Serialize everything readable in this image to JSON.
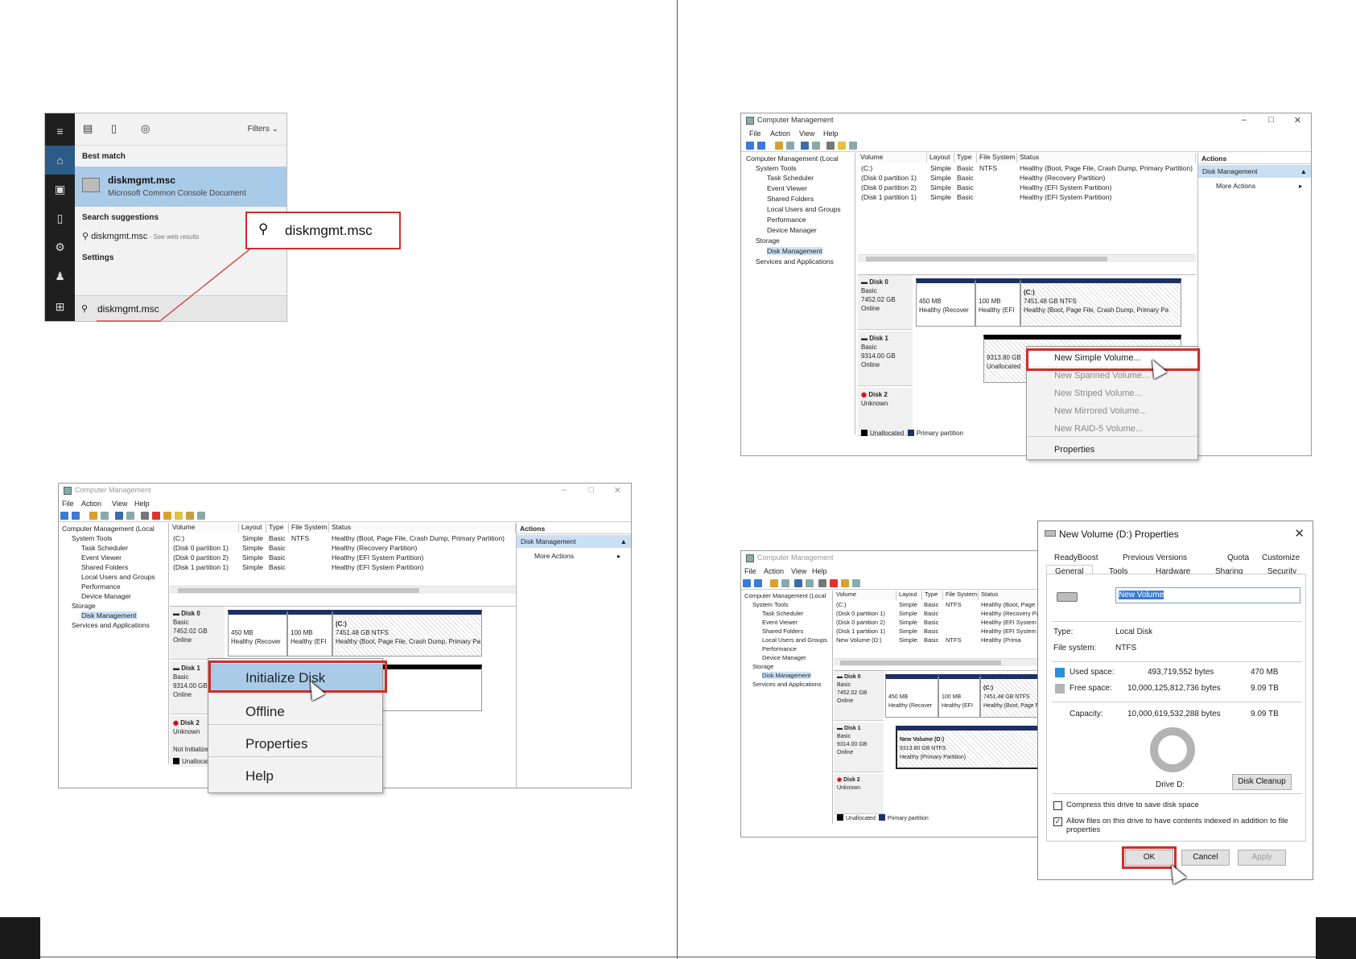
{
  "search": {
    "filters": "Filters",
    "best_match_heading": "Best match",
    "result_title": "diskmgmt.msc",
    "result_subtitle": "Microsoft Common Console Document",
    "suggestions_heading": "Search suggestions",
    "suggestion": "diskmgmt.msc",
    "suggestion_hint": " - See web results",
    "settings_heading": "Settings",
    "query": "diskmgmt.msc",
    "callout_query": "diskmgmt.msc"
  },
  "cm": {
    "title": "Computer Management",
    "menu": [
      "File",
      "Action",
      "View",
      "Help"
    ],
    "tree": {
      "root": "Computer Management (Local",
      "system_tools": "System Tools",
      "task_scheduler": "Task Scheduler",
      "event_viewer": "Event Viewer",
      "shared_folders": "Shared Folders",
      "local_users": "Local Users and Groups",
      "performance": "Performance",
      "device_manager": "Device Manager",
      "storage": "Storage",
      "disk_management": "Disk Management",
      "services": "Services and Applications"
    },
    "columns": [
      "Volume",
      "Layout",
      "Type",
      "File System",
      "Status"
    ],
    "volumes": [
      {
        "volume": "(C:)",
        "layout": "Simple",
        "type": "Basic",
        "fs": "NTFS",
        "status": "Healthy (Boot, Page File, Crash Dump, Primary Partition)"
      },
      {
        "volume": "(Disk 0 partition 1)",
        "layout": "Simple",
        "type": "Basic",
        "fs": "",
        "status": "Healthy (Recovery Partition)"
      },
      {
        "volume": "(Disk 0 partition 2)",
        "layout": "Simple",
        "type": "Basic",
        "fs": "",
        "status": "Healthy (EFI System Partition)"
      },
      {
        "volume": "(Disk 1 partition 1)",
        "layout": "Simple",
        "type": "Basic",
        "fs": "",
        "status": "Healthy (EFI System Partition)"
      }
    ],
    "new_volume_row": {
      "volume": "New Volume (D:)",
      "layout": "Simple",
      "type": "Basic",
      "fs": "NTFS",
      "status": "Healthy (Prima"
    },
    "disk0": {
      "name": "Disk 0",
      "kind": "Basic",
      "size": "7452.02 GB",
      "state": "Online",
      "p1_size": "450 MB",
      "p1_status": "Healthy (Recover",
      "p2_size": "100 MB",
      "p2_status": "Healthy (EFI",
      "p3_name": "(C:)",
      "p3_size": "7451.48 GB NTFS",
      "p3_status": "Healthy (Boot, Page File, Crash Dump, Primary Pa"
    },
    "disk1": {
      "name": "Disk 1",
      "kind": "Basic",
      "size": "9314.00 GB",
      "state": "Online",
      "unalloc_size": "9313.80 GB",
      "unalloc_label": "Unallocated",
      "newvol_name": "New Volume (D:)",
      "newvol_size": "9313.80 GB NTFS",
      "newvol_status": "Healthy (Primary Partition)"
    },
    "disk2": {
      "name": "Disk 2",
      "kind": "Unknown",
      "state": "Not Initialized"
    },
    "legend": {
      "unallocated": "Unallocated",
      "primary": "Primary partition"
    },
    "actions": {
      "heading": "Actions",
      "selected": "Disk Management",
      "more": "More Actions"
    }
  },
  "ctx_init": [
    "Initialize Disk",
    "Offline",
    "Properties",
    "Help"
  ],
  "ctx_volume": [
    "New Simple Volume...",
    "New Spanned Volume...",
    "New Striped Volume...",
    "New Mirrored Volume...",
    "New RAID-5 Volume...",
    "Properties"
  ],
  "props": {
    "title": "New Volume (D:) Properties",
    "tabs_row1": [
      "ReadyBoost",
      "Previous Versions",
      "Quota",
      "Customize"
    ],
    "tabs_row2": [
      "General",
      "Tools",
      "Hardware",
      "Sharing",
      "Security"
    ],
    "name_value": "New Volume",
    "type_label": "Type:",
    "type_value": "Local Disk",
    "fs_label": "File system:",
    "fs_value": "NTFS",
    "used_label": "Used space:",
    "used_bytes": "493,719,552 bytes",
    "used_h": "470 MB",
    "free_label": "Free space:",
    "free_bytes": "10,000,125,812,736 bytes",
    "free_h": "9.09 TB",
    "cap_label": "Capacity:",
    "cap_bytes": "10,000,619,532,288 bytes",
    "cap_h": "9.09 TB",
    "drive_label": "Drive D:",
    "cleanup": "Disk Cleanup",
    "compress": "Compress this drive to save disk space",
    "index": "Allow files on this drive to have contents indexed in addition to file properties",
    "ok": "OK",
    "cancel": "Cancel",
    "apply": "Apply"
  },
  "colors": {
    "accent_red": "#d42b2b",
    "selection_blue": "#a9cbe8",
    "partition_header": "#1d2f63",
    "used_space": "#2e8fd6",
    "free_space": "#b3b3b3"
  },
  "icons": [
    "search-icon",
    "home-icon",
    "globe-icon",
    "document-icon",
    "settings-icon",
    "windows-icon",
    "disk-icon",
    "arrow-cursor-icon"
  ]
}
